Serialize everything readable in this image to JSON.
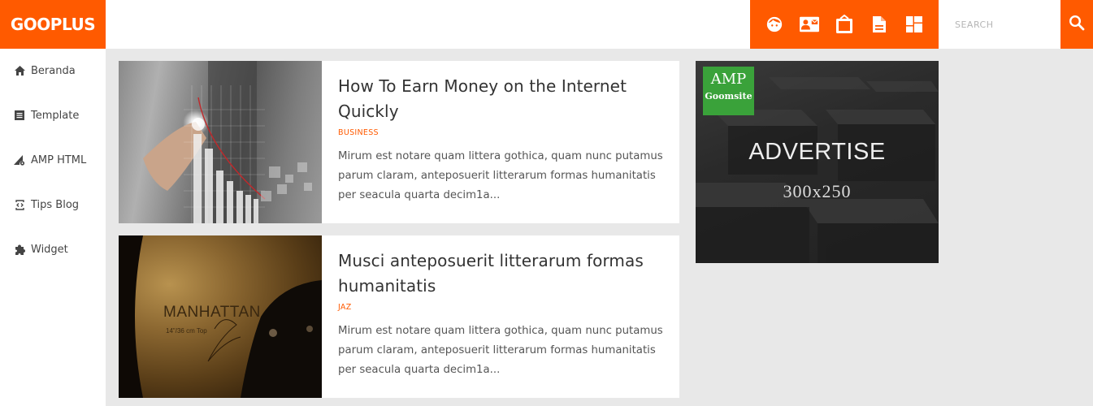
{
  "header": {
    "logo": "GOOPLUS",
    "icons": [
      {
        "name": "face-icon"
      },
      {
        "name": "contact-mail-icon"
      },
      {
        "name": "tv-icon"
      },
      {
        "name": "document-icon"
      },
      {
        "name": "dashboard-icon"
      }
    ],
    "search": {
      "placeholder": "SEARCH",
      "value": ""
    },
    "accent_color": "#ff5a00"
  },
  "sidebar": {
    "items": [
      {
        "label": "Beranda",
        "icon": "home-icon"
      },
      {
        "label": "Template",
        "icon": "list-icon"
      },
      {
        "label": "AMP HTML",
        "icon": "signal-settings-icon"
      },
      {
        "label": "Tips Blog",
        "icon": "code-icon"
      },
      {
        "label": "Widget",
        "icon": "puzzle-icon"
      }
    ]
  },
  "posts": [
    {
      "title": "How To Earn Money on the Internet Quickly",
      "category": "BUSINESS",
      "excerpt": "Mirum est notare quam littera gothica, quam nunc putamus parum claram, anteposuerit litterarum formas humanitatis per seacula quarta decim1a...",
      "thumbnail": "business-chart-image"
    },
    {
      "title": "Musci anteposuerit litterarum formas humanitatis",
      "category": "JAZ",
      "excerpt": "Mirum est notare quam littera gothica, quam nunc putamus parum claram, anteposuerit litterarum formas humanitatis per seacula quarta decim1a...",
      "thumbnail": "manhattan-jazz-cymbal-image",
      "thumb_text": {
        "brand": "MANHATTAN",
        "spec": "14\"/36 cm Top",
        "script": "Jazz"
      }
    }
  ],
  "ad": {
    "badge_line1": "AMP",
    "badge_line2": "Goomsite",
    "headline": "ADVERTISE",
    "size": "300x250"
  }
}
